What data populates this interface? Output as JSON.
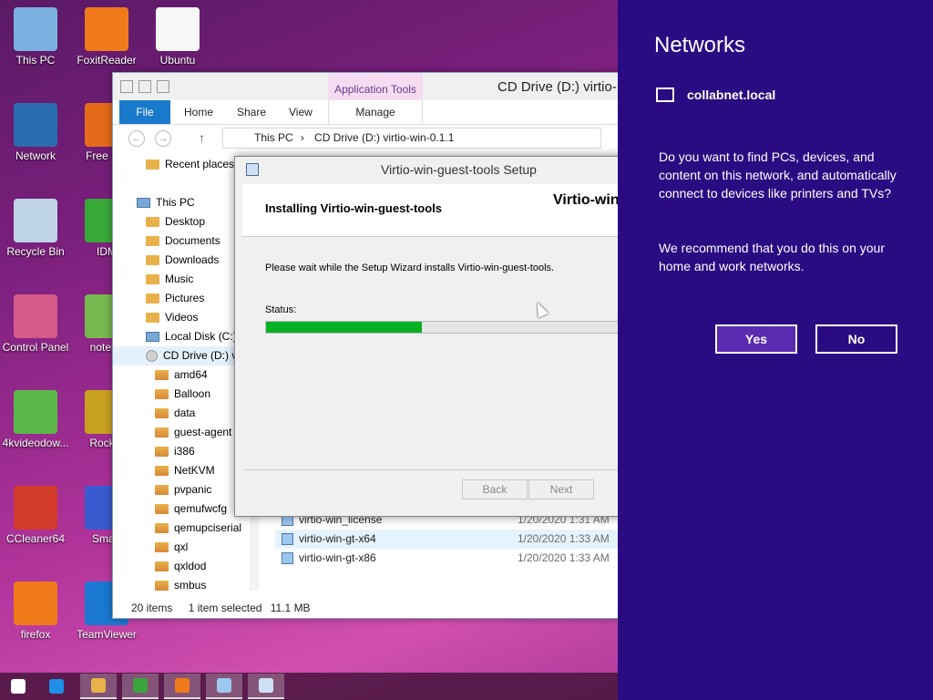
{
  "desktop": {
    "icons": [
      {
        "label": "This PC",
        "color": "#7ab0e0"
      },
      {
        "label": "FoxitReader",
        "color": "#f07a1a"
      },
      {
        "label": "Ubuntu",
        "color": "#f7f7f7"
      },
      {
        "label": "Network",
        "color": "#2a6cb0"
      },
      {
        "label": "Free Sof",
        "color": "#e66a1a"
      },
      {
        "label": "Recycle Bin",
        "color": "#bfd3e6"
      },
      {
        "label": "IDM",
        "color": "#38a838"
      },
      {
        "label": "Control Panel",
        "color": "#d45a8a"
      },
      {
        "label": "notepa",
        "color": "#78b850"
      },
      {
        "label": "4kvideodow...",
        "color": "#5cb84a"
      },
      {
        "label": "Rocket",
        "color": "#c8a020"
      },
      {
        "label": "CCleaner64",
        "color": "#d23a2a"
      },
      {
        "label": "Smart",
        "color": "#3a5ad0"
      },
      {
        "label": "firefox",
        "color": "#f07a1a"
      },
      {
        "label": "TeamViewer",
        "color": "#1a78d0"
      }
    ]
  },
  "explorer": {
    "context_tab": "Application Tools",
    "title": "CD Drive (D:) virtio-",
    "ribbon": {
      "file": "File",
      "home": "Home",
      "share": "Share",
      "view": "View",
      "manage": "Manage"
    },
    "address": [
      "This PC",
      "CD Drive (D:) virtio-win-0.1.1"
    ],
    "nav": [
      {
        "label": "Recent places",
        "type": "fold"
      },
      {
        "label": "This PC",
        "type": "pc"
      },
      {
        "label": "Desktop",
        "type": "fold"
      },
      {
        "label": "Documents",
        "type": "fold"
      },
      {
        "label": "Downloads",
        "type": "fold"
      },
      {
        "label": "Music",
        "type": "fold"
      },
      {
        "label": "Pictures",
        "type": "fold"
      },
      {
        "label": "Videos",
        "type": "fold"
      },
      {
        "label": "Local Disk (C:)",
        "type": "pc"
      },
      {
        "label": "CD Drive (D:) v",
        "type": "cd"
      },
      {
        "label": "amd64",
        "type": "o"
      },
      {
        "label": "Balloon",
        "type": "o"
      },
      {
        "label": "data",
        "type": "o"
      },
      {
        "label": "guest-agent",
        "type": "o"
      },
      {
        "label": "i386",
        "type": "o"
      },
      {
        "label": "NetKVM",
        "type": "o"
      },
      {
        "label": "pvpanic",
        "type": "o"
      },
      {
        "label": "qemufwcfg",
        "type": "o"
      },
      {
        "label": "qemupciserial",
        "type": "o"
      },
      {
        "label": "qxl",
        "type": "o"
      },
      {
        "label": "qxldod",
        "type": "o"
      },
      {
        "label": "smbus",
        "type": "o"
      }
    ],
    "files": [
      {
        "name": "virtio-win_license",
        "date": "1/20/2020 1:31 AM"
      },
      {
        "name": "virtio-win-gt-x64",
        "date": "1/20/2020 1:33 AM"
      },
      {
        "name": "virtio-win-gt-x86",
        "date": "1/20/2020 1:33 AM"
      }
    ],
    "status": {
      "items": "20 items",
      "selected": "1 item selected",
      "size": "11.1 MB"
    }
  },
  "setup": {
    "title": "Virtio-win-guest-tools Setup",
    "heading": "Installing Virtio-win-guest-tools",
    "brand": "Virtio-win",
    "message": "Please wait while the Setup Wizard installs Virtio-win-guest-tools.",
    "status_label": "Status:",
    "progress": 0.43,
    "progress_color": "#06b025",
    "back": "Back",
    "next": "Next"
  },
  "networks": {
    "title": "Networks",
    "network_name": "collabnet.local",
    "question": "Do you want to find PCs, devices, and content on this network, and automatically connect to devices like printers and TVs?",
    "recommendation": "We recommend that you do this on your home and work networks.",
    "yes": "Yes",
    "no": "No",
    "background": "#2a0b82"
  },
  "taskbar": {
    "items": [
      {
        "name": "start-button",
        "color": "#ffffff"
      },
      {
        "name": "internet-explorer-icon",
        "color": "#1e8ee6"
      },
      {
        "name": "file-explorer-icon",
        "color": "#e8b14a"
      },
      {
        "name": "store-icon",
        "color": "#3ba53b"
      },
      {
        "name": "firefox-icon",
        "color": "#f07a1a"
      },
      {
        "name": "setup-installer-icon",
        "color": "#9ec7ef"
      },
      {
        "name": "setup-installer-icon-2",
        "color": "#cfe0f5"
      }
    ]
  }
}
